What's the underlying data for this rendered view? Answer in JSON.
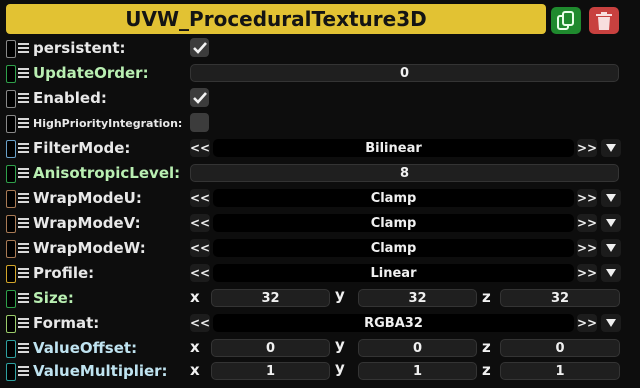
{
  "header": {
    "title": "UVW_ProceduralTexture3D",
    "copy_icon": "copy-icon",
    "delete_icon": "trash-icon",
    "colors": {
      "title_bar": "#e2c233",
      "copy_button": "#1f8a2e",
      "delete_button": "#c8413f"
    }
  },
  "enum_arrows": {
    "prev": "<<",
    "next": ">>"
  },
  "vector_axes": {
    "x": "x",
    "y": "y",
    "z": "z"
  },
  "properties": {
    "persistent": {
      "label": "persistent:",
      "checked": true
    },
    "update_order": {
      "label": "UpdateOrder:",
      "value": "0"
    },
    "enabled": {
      "label": "Enabled:",
      "checked": true
    },
    "high_priority_integration": {
      "label": "HighPriorityIntegration:",
      "checked": false
    },
    "filter_mode": {
      "label": "FilterMode:",
      "value": "Bilinear"
    },
    "anisotropic_level": {
      "label": "AnisotropicLevel:",
      "value": "8"
    },
    "wrap_mode_u": {
      "label": "WrapModeU:",
      "value": "Clamp"
    },
    "wrap_mode_v": {
      "label": "WrapModeV:",
      "value": "Clamp"
    },
    "wrap_mode_w": {
      "label": "WrapModeW:",
      "value": "Clamp"
    },
    "profile": {
      "label": "Profile:",
      "value": "Linear"
    },
    "size": {
      "label": "Size:",
      "x": "32",
      "y": "32",
      "z": "32"
    },
    "format": {
      "label": "Format:",
      "value": "RGBA32"
    },
    "value_offset": {
      "label": "ValueOffset:",
      "x": "0",
      "y": "0",
      "z": "0"
    },
    "value_multiplier": {
      "label": "ValueMultiplier:",
      "x": "1",
      "y": "1",
      "z": "1"
    }
  }
}
